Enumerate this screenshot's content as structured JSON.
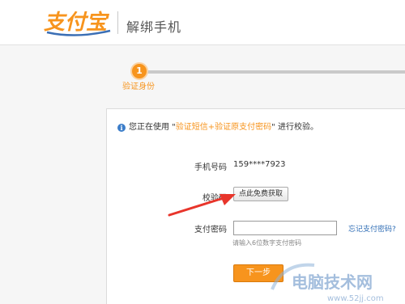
{
  "header": {
    "logo_text": "支付宝",
    "title": "解绑手机"
  },
  "steps": {
    "items": [
      {
        "number": "1",
        "label": "验证身份",
        "active": true
      }
    ]
  },
  "form": {
    "notice": {
      "prefix": "您正在使用 \"",
      "highlight": "验证短信+验证原支付密码",
      "suffix": "\" 进行校验。"
    },
    "phone_label": "手机号码",
    "phone_value": "159****7923",
    "code_label": "校验码",
    "get_code_button": "点此免费获取",
    "pay_password_label": "支付密码",
    "pay_password_value": "",
    "pay_password_hint": "请输入6位数字支付密码",
    "forgot_link": "忘记支付密码?",
    "next_button": "下一步"
  },
  "watermark": {
    "text": "电脑技术网",
    "url": "www.52jj.com"
  },
  "colors": {
    "brand_orange": "#f7941d",
    "link_blue": "#2f6db5",
    "arrow_red": "#e8352b"
  }
}
